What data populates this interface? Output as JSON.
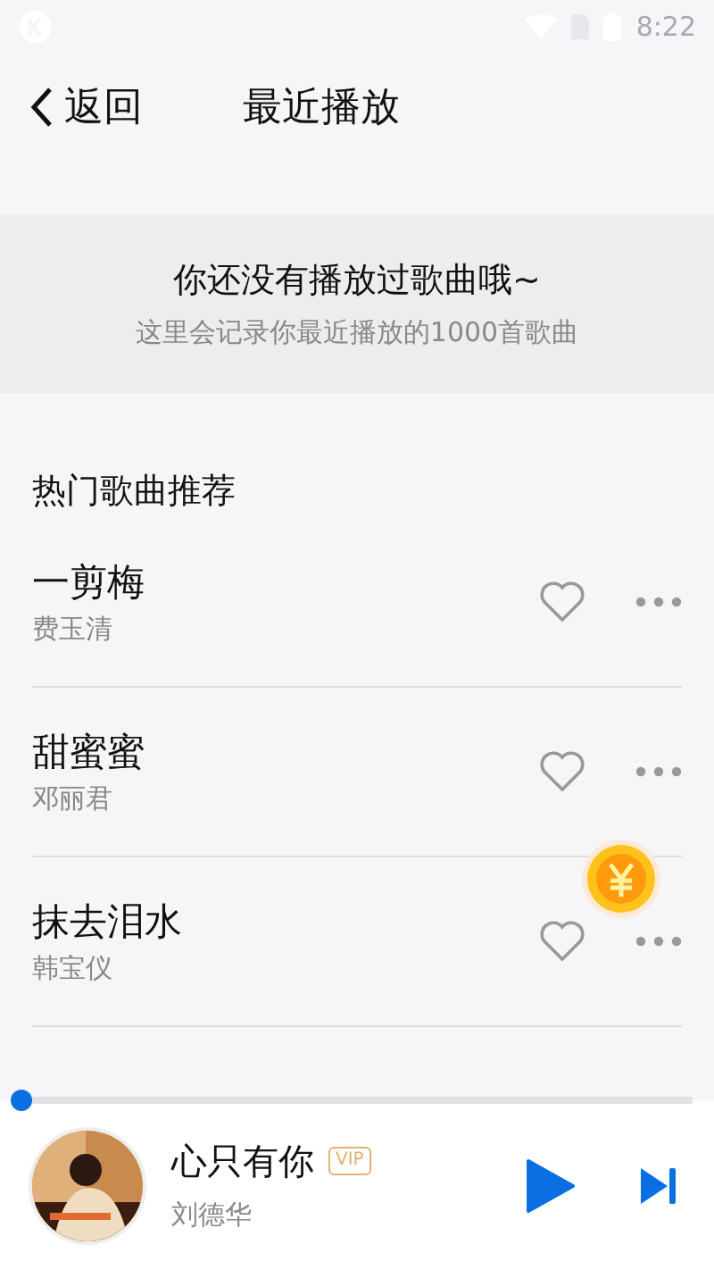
{
  "status_bar": {
    "time": "8:22"
  },
  "header": {
    "back_label": "返回",
    "title": "最近播放"
  },
  "empty_notice": {
    "title": "你还没有播放过歌曲哦~",
    "subtitle": "这里会记录你最近播放的1000首歌曲"
  },
  "section_title": "热门歌曲推荐",
  "songs": [
    {
      "title": "一剪梅",
      "artist": "费玉清",
      "liked": false
    },
    {
      "title": "甜蜜蜜",
      "artist": "邓丽君",
      "liked": false
    },
    {
      "title": "抹去泪水",
      "artist": "韩宝仪",
      "liked": false
    }
  ],
  "player": {
    "title": "心只有你",
    "badge": "VIP",
    "artist": "刘德华",
    "playing": false,
    "level": 0
  }
}
